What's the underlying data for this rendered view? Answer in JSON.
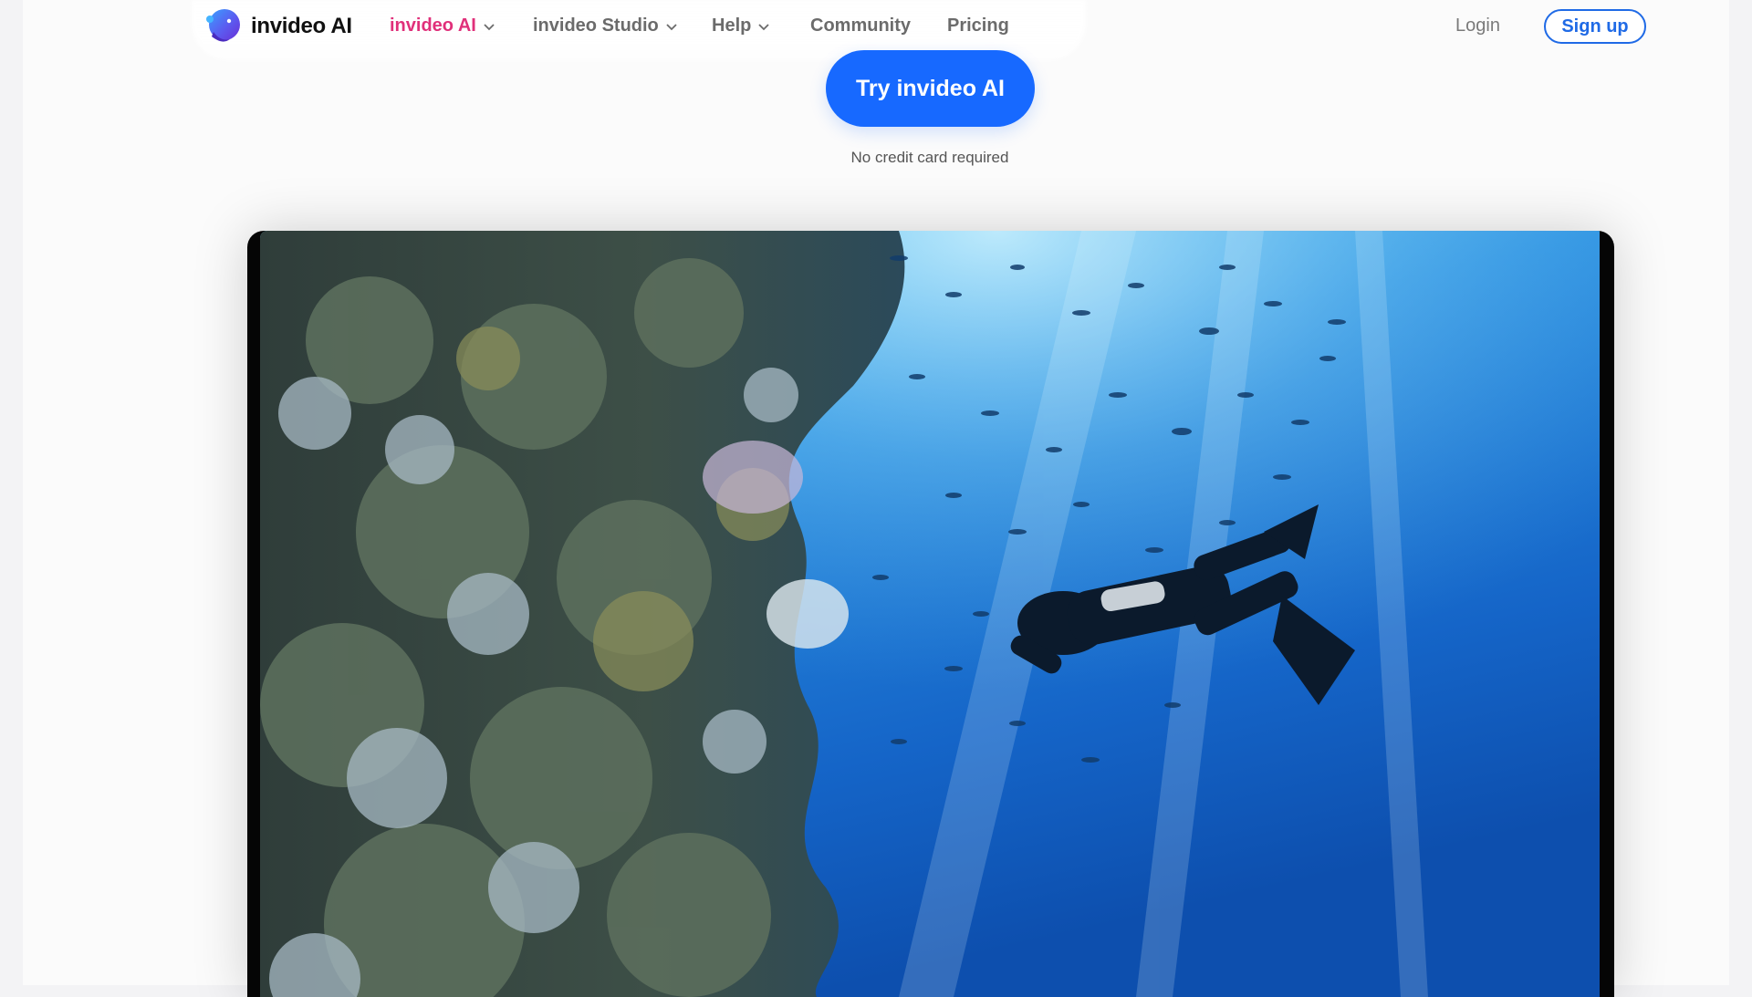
{
  "brand": {
    "name": "invideo AI"
  },
  "nav": {
    "items": [
      {
        "label": "invideo AI",
        "has_dropdown": true,
        "active": true
      },
      {
        "label": "invideo Studio",
        "has_dropdown": true,
        "active": false
      },
      {
        "label": "Help",
        "has_dropdown": true,
        "active": false
      },
      {
        "label": "Community",
        "has_dropdown": false,
        "active": false
      },
      {
        "label": "Pricing",
        "has_dropdown": false,
        "active": false
      }
    ],
    "login_label": "Login",
    "signup_label": "Sign up"
  },
  "hero": {
    "cta_label": "Try invideo AI",
    "note": "No credit card required"
  },
  "video": {
    "subject": "underwater-reef-diver"
  },
  "colors": {
    "accent_blue": "#1769ff",
    "active_pink": "#e0307a",
    "signup_border": "#1f6ae6"
  }
}
